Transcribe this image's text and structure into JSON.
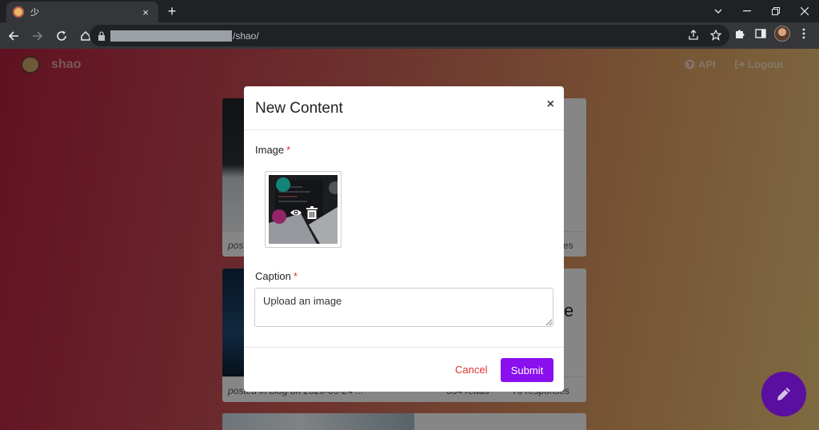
{
  "browser": {
    "tab_title": "少",
    "tab_close": "×",
    "new_tab": "+",
    "url_path": "/shao/"
  },
  "app": {
    "brand": "shao",
    "nav": {
      "api": "API",
      "logout": "Logout"
    }
  },
  "feed": {
    "cards": [
      {
        "posted": "post",
        "stat": "es"
      },
      {
        "posted": "posted in blog on 2020-09-24 ...",
        "stat_a": "334 reads",
        "stat_b": "70 responses",
        "side_char": "e"
      }
    ]
  },
  "modal": {
    "title": "New Content",
    "close": "×",
    "image_label": "Image",
    "required_mark": "*",
    "caption_label": "Caption",
    "caption_value": "Upload an image",
    "cancel_label": "Cancel",
    "submit_label": "Submit"
  },
  "colors": {
    "accent": "#8a10f0",
    "danger": "#e0302c",
    "fab": "#5a0fa0"
  },
  "icons": {
    "preview": "eye-icon",
    "delete": "trash-icon",
    "fab": "pencil-icon",
    "api": "question-circle-icon",
    "logout": "sign-out-icon"
  }
}
